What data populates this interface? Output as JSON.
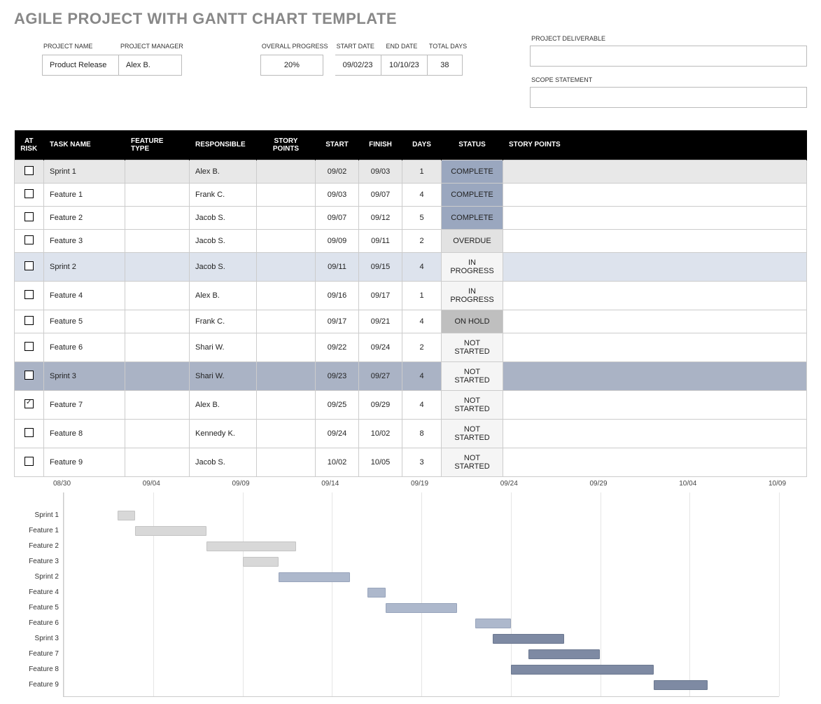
{
  "title": "AGILE PROJECT WITH GANTT CHART TEMPLATE",
  "meta": {
    "project_name_label": "PROJECT NAME",
    "project_name": "Product Release",
    "project_manager_label": "PROJECT MANAGER",
    "project_manager": "Alex B.",
    "overall_progress_label": "OVERALL PROGRESS",
    "overall_progress": "20%",
    "start_date_label": "START DATE",
    "start_date": "09/02/23",
    "end_date_label": "END DATE",
    "end_date": "10/10/23",
    "total_days_label": "TOTAL DAYS",
    "total_days": "38",
    "deliverable_label": "PROJECT DELIVERABLE",
    "deliverable": "",
    "scope_label": "SCOPE STATEMENT",
    "scope": ""
  },
  "columns": {
    "at_risk": "AT RISK",
    "task_name": "TASK NAME",
    "feature_type": "FEATURE TYPE",
    "responsible": "RESPONSIBLE",
    "story_points": "STORY POINTS",
    "start": "START",
    "finish": "FINISH",
    "days": "DAYS",
    "status": "STATUS",
    "story_points2": "STORY POINTS"
  },
  "rows": [
    {
      "at_risk": false,
      "task": "Sprint 1",
      "feature_type": "",
      "responsible": "Alex B.",
      "sp": "",
      "start": "09/02",
      "finish": "09/03",
      "days": "1",
      "status": "COMPLETE",
      "status_cls": "complete",
      "row_cls": "row-e1"
    },
    {
      "at_risk": false,
      "task": "Feature 1",
      "feature_type": "",
      "responsible": "Frank C.",
      "sp": "",
      "start": "09/03",
      "finish": "09/07",
      "days": "4",
      "status": "COMPLETE",
      "status_cls": "complete",
      "row_cls": ""
    },
    {
      "at_risk": false,
      "task": "Feature 2",
      "feature_type": "",
      "responsible": "Jacob S.",
      "sp": "",
      "start": "09/07",
      "finish": "09/12",
      "days": "5",
      "status": "COMPLETE",
      "status_cls": "complete",
      "row_cls": ""
    },
    {
      "at_risk": false,
      "task": "Feature 3",
      "feature_type": "",
      "responsible": "Jacob S.",
      "sp": "",
      "start": "09/09",
      "finish": "09/11",
      "days": "2",
      "status": "OVERDUE",
      "status_cls": "overdue",
      "row_cls": ""
    },
    {
      "at_risk": false,
      "task": "Sprint 2",
      "feature_type": "",
      "responsible": "Jacob S.",
      "sp": "",
      "start": "09/11",
      "finish": "09/15",
      "days": "4",
      "status": "IN PROGRESS",
      "status_cls": "inprogress",
      "row_cls": "row-e2"
    },
    {
      "at_risk": false,
      "task": "Feature 4",
      "feature_type": "",
      "responsible": "Alex B.",
      "sp": "",
      "start": "09/16",
      "finish": "09/17",
      "days": "1",
      "status": "IN PROGRESS",
      "status_cls": "inprogress",
      "row_cls": ""
    },
    {
      "at_risk": false,
      "task": "Feature 5",
      "feature_type": "",
      "responsible": "Frank C.",
      "sp": "",
      "start": "09/17",
      "finish": "09/21",
      "days": "4",
      "status": "ON HOLD",
      "status_cls": "onhold",
      "row_cls": ""
    },
    {
      "at_risk": false,
      "task": "Feature 6",
      "feature_type": "",
      "responsible": "Shari W.",
      "sp": "",
      "start": "09/22",
      "finish": "09/24",
      "days": "2",
      "status": "NOT STARTED",
      "status_cls": "notstarted",
      "row_cls": ""
    },
    {
      "at_risk": false,
      "task": "Sprint 3",
      "feature_type": "",
      "responsible": "Shari W.",
      "sp": "",
      "start": "09/23",
      "finish": "09/27",
      "days": "4",
      "status": "NOT STARTED",
      "status_cls": "notstarted",
      "row_cls": "row-e3"
    },
    {
      "at_risk": true,
      "task": "Feature 7",
      "feature_type": "",
      "responsible": "Alex B.",
      "sp": "",
      "start": "09/25",
      "finish": "09/29",
      "days": "4",
      "status": "NOT STARTED",
      "status_cls": "notstarted",
      "row_cls": ""
    },
    {
      "at_risk": false,
      "task": "Feature 8",
      "feature_type": "",
      "responsible": "Kennedy K.",
      "sp": "",
      "start": "09/24",
      "finish": "10/02",
      "days": "8",
      "status": "NOT STARTED",
      "status_cls": "notstarted",
      "row_cls": ""
    },
    {
      "at_risk": false,
      "task": "Feature 9",
      "feature_type": "",
      "responsible": "Jacob S.",
      "sp": "",
      "start": "10/02",
      "finish": "10/05",
      "days": "3",
      "status": "NOT STARTED",
      "status_cls": "notstarted",
      "row_cls": ""
    }
  ],
  "chart_data": {
    "type": "bar",
    "orientation": "horizontal-gantt",
    "x_axis": {
      "start": "08/30",
      "end": "10/09",
      "ticks": [
        "08/30",
        "09/04",
        "09/09",
        "09/14",
        "09/19",
        "09/24",
        "09/29",
        "10/04",
        "10/09"
      ]
    },
    "categories": [
      "Sprint 1",
      "Feature 1",
      "Feature 2",
      "Feature 3",
      "Sprint 2",
      "Feature 4",
      "Feature 5",
      "Feature 6",
      "Sprint 3",
      "Feature 7",
      "Feature 8",
      "Feature 9"
    ],
    "bars": [
      {
        "label": "Sprint 1",
        "start": "09/02",
        "end": "09/03",
        "color": "light"
      },
      {
        "label": "Feature 1",
        "start": "09/03",
        "end": "09/07",
        "color": "light"
      },
      {
        "label": "Feature 2",
        "start": "09/07",
        "end": "09/12",
        "color": "light"
      },
      {
        "label": "Feature 3",
        "start": "09/09",
        "end": "09/11",
        "color": "light"
      },
      {
        "label": "Sprint 2",
        "start": "09/11",
        "end": "09/15",
        "color": "mid"
      },
      {
        "label": "Feature 4",
        "start": "09/16",
        "end": "09/17",
        "color": "mid"
      },
      {
        "label": "Feature 5",
        "start": "09/17",
        "end": "09/21",
        "color": "mid"
      },
      {
        "label": "Feature 6",
        "start": "09/22",
        "end": "09/24",
        "color": "mid"
      },
      {
        "label": "Sprint 3",
        "start": "09/23",
        "end": "09/27",
        "color": "dark"
      },
      {
        "label": "Feature 7",
        "start": "09/25",
        "end": "09/29",
        "color": "dark"
      },
      {
        "label": "Feature 8",
        "start": "09/24",
        "end": "10/02",
        "color": "dark"
      },
      {
        "label": "Feature 9",
        "start": "10/02",
        "end": "10/05",
        "color": "dark"
      }
    ],
    "colors": {
      "light": "#d8d8d8",
      "mid": "#adb8cc",
      "dark": "#7e8aa3"
    }
  }
}
